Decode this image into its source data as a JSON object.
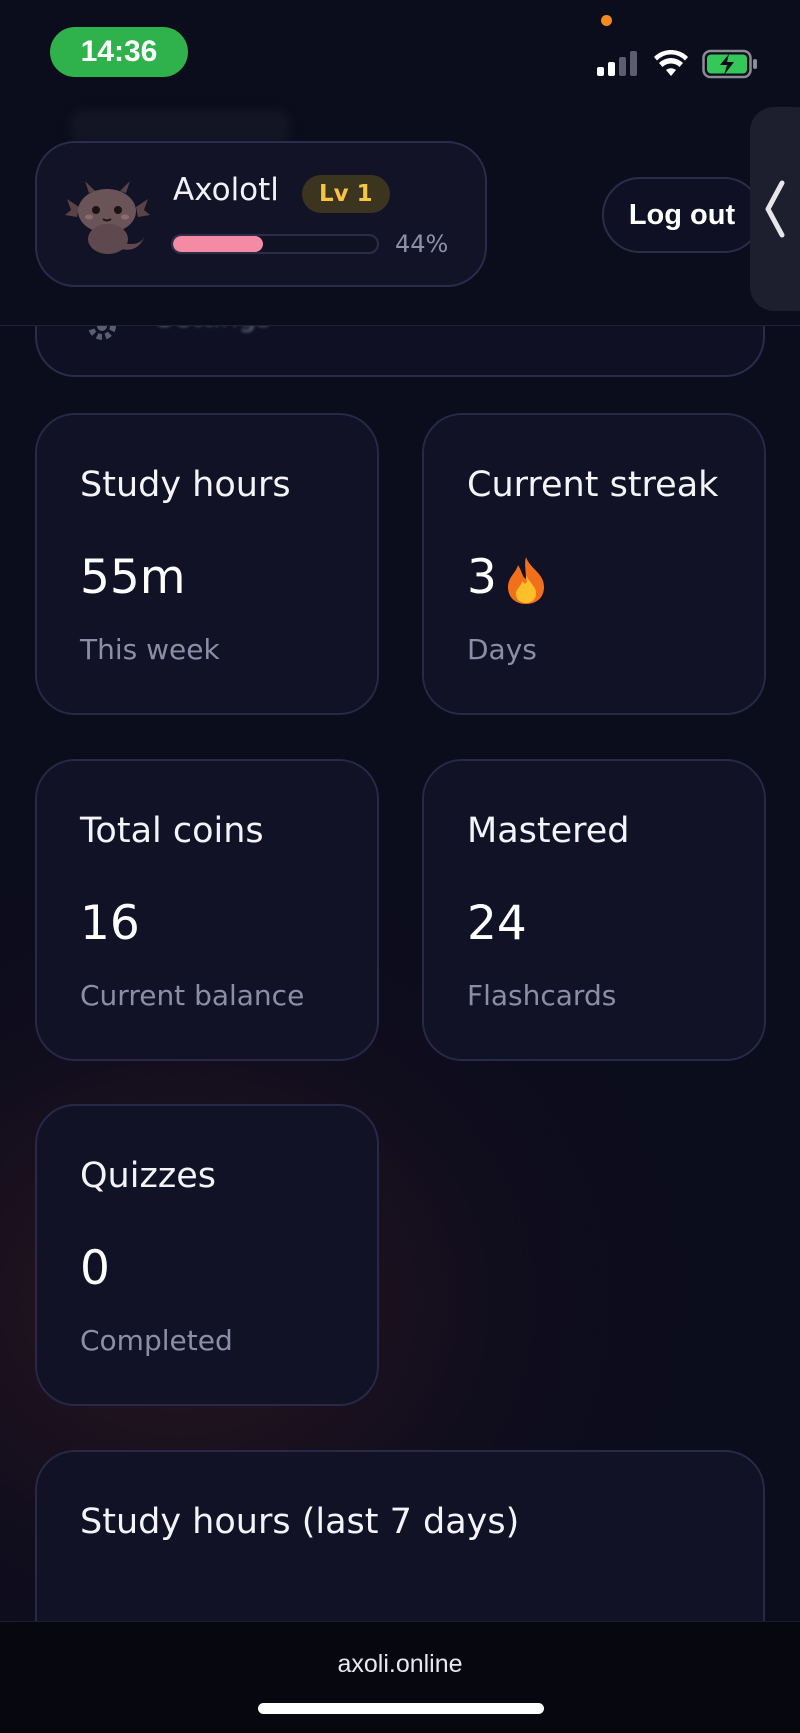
{
  "status_bar": {
    "time": "14:36",
    "time_pill_color": "#2fb24c",
    "icons": [
      "signal-icon",
      "wifi-icon",
      "battery-charging-icon"
    ]
  },
  "profile": {
    "name": "Axolotl",
    "level": "Lv 1",
    "xp_percent_label": "44%",
    "xp_fraction": 0.44,
    "xp_bar_color": "#f48aa4",
    "avatar": "axolotl-avatar-icon"
  },
  "header": {
    "logout_label": "Log out",
    "side_panel_icon": "chevron-left-icon"
  },
  "settings": {
    "label": "Settings",
    "icon": "gear-icon"
  },
  "stats": {
    "study_hours": {
      "title": "Study hours",
      "value": "55m",
      "sub": "This week"
    },
    "current_streak": {
      "title": "Current streak",
      "value": "3",
      "emoji": "🔥",
      "sub": "Days"
    },
    "total_coins": {
      "title": "Total coins",
      "value": "16",
      "sub": "Current balance"
    },
    "mastered": {
      "title": "Mastered",
      "value": "24",
      "sub": "Flashcards"
    },
    "quizzes": {
      "title": "Quizzes",
      "value": "0",
      "sub": "Completed"
    }
  },
  "chart_section": {
    "title": "Study hours (last 7 days)"
  },
  "browser": {
    "url": "axoli.online"
  }
}
